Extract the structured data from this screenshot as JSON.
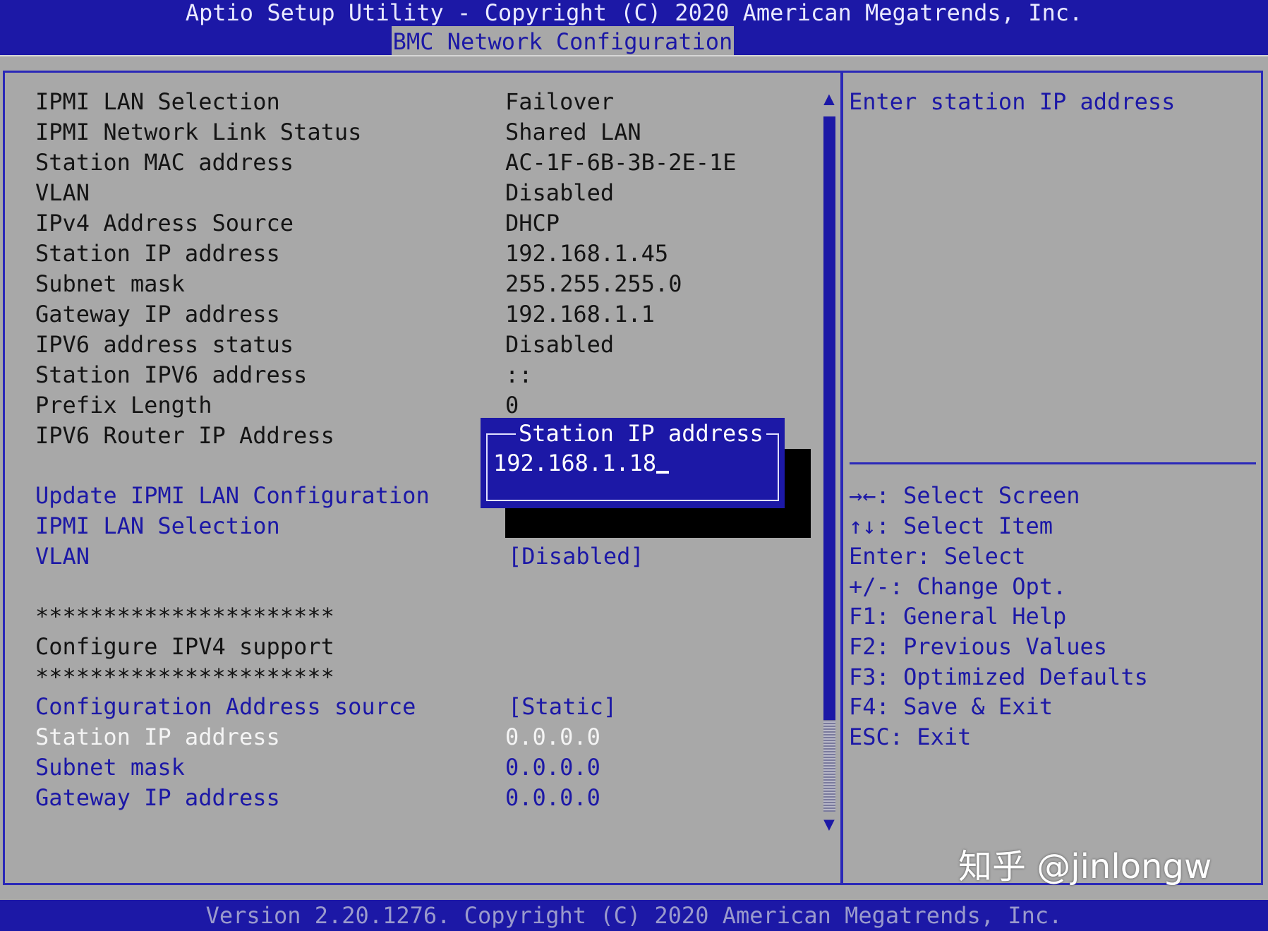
{
  "header": {
    "title": "Aptio Setup Utility - Copyright (C) 2020 American Megatrends, Inc.",
    "tab": "BMC Network Configuration"
  },
  "settings": {
    "info": [
      {
        "label": "IPMI LAN Selection",
        "value": "Failover"
      },
      {
        "label": "IPMI Network Link Status",
        "value": "Shared LAN"
      },
      {
        "label": "Station MAC address",
        "value": "AC-1F-6B-3B-2E-1E"
      },
      {
        "label": "VLAN",
        "value": "Disabled"
      },
      {
        "label": "IPv4 Address Source",
        "value": "DHCP"
      },
      {
        "label": "Station IP address",
        "value": "192.168.1.45"
      },
      {
        "label": "Subnet mask",
        "value": "255.255.255.0"
      },
      {
        "label": "Gateway IP address",
        "value": "192.168.1.1"
      },
      {
        "label": "IPV6 address status",
        "value": "Disabled"
      },
      {
        "label": "Station IPV6 address",
        "value": "::"
      },
      {
        "label": "Prefix Length",
        "value": "0"
      },
      {
        "label": "IPV6 Router IP Address",
        "value": ""
      }
    ],
    "options": [
      {
        "label": "Update IPMI LAN Configuration",
        "value": ""
      },
      {
        "label": "IPMI LAN Selection",
        "value": ""
      },
      {
        "label": "VLAN",
        "value": "[Disabled]"
      }
    ],
    "separator_top": "**********************",
    "section_title": "Configure IPV4 support",
    "separator_bottom": "**********************",
    "ipv4": [
      {
        "label": "Configuration Address source",
        "value": "[Static]",
        "state": "normal"
      },
      {
        "label": "Station IP address",
        "value": "0.0.0.0",
        "state": "selected"
      },
      {
        "label": "Subnet mask",
        "value": "0.0.0.0",
        "state": "normal"
      },
      {
        "label": "Gateway IP address",
        "value": "0.0.0.0",
        "state": "normal"
      }
    ]
  },
  "popup": {
    "title": "Station IP address",
    "value": "192.168.1.18"
  },
  "help": {
    "description": "Enter station IP address",
    "keys": [
      {
        "key": "→←",
        "action": ": Select Screen"
      },
      {
        "key": "↑↓",
        "action": ": Select Item"
      },
      {
        "key": "Enter",
        "action": ": Select"
      },
      {
        "key": "+/-",
        "action": ": Change Opt."
      },
      {
        "key": "F1",
        "action": ": General Help"
      },
      {
        "key": "F2",
        "action": ": Previous Values"
      },
      {
        "key": "F3",
        "action": ": Optimized Defaults"
      },
      {
        "key": "F4",
        "action": ": Save & Exit"
      },
      {
        "key": "ESC",
        "action": ": Exit"
      }
    ]
  },
  "footer": {
    "text": "Version 2.20.1276. Copyright (C) 2020 American Megatrends, Inc."
  },
  "watermark": "知乎 @jinlongw",
  "colors": {
    "background": "#a8a8a8",
    "bios_blue": "#1c18a6",
    "selected_text": "#f4f4f4",
    "static_text": "#141414"
  },
  "icons": {
    "scroll_up": "▲",
    "scroll_down": "▼"
  }
}
